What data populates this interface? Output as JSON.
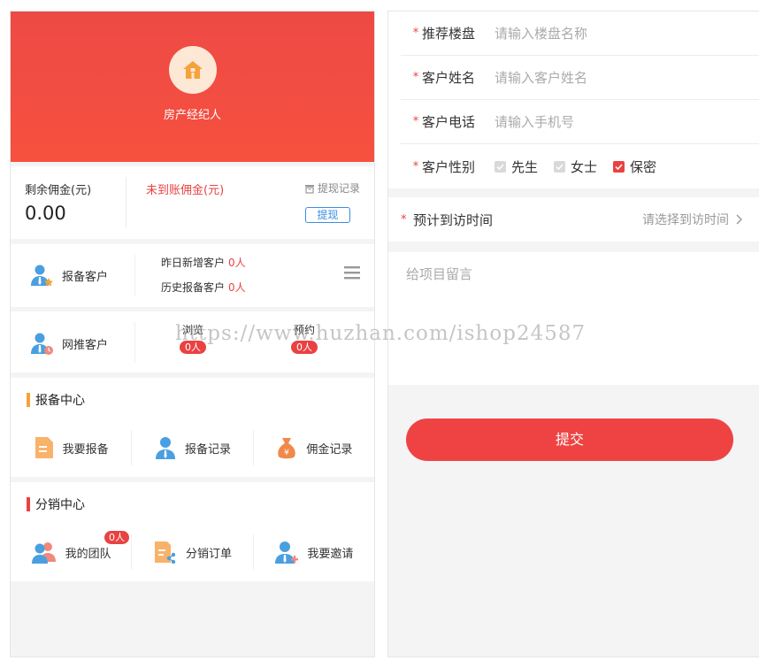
{
  "colors": {
    "brand_red": "#ee4a45",
    "accent_orange": "#f5a23a",
    "link_blue": "#3b8de3"
  },
  "hero": {
    "role": "房产经纪人",
    "icon": "house-icon"
  },
  "commission": {
    "remaining_label": "剩余佣金(元)",
    "remaining_amount": "0.00",
    "unbilled_label": "未到账佣金(元)",
    "history_label": "提现记录",
    "withdraw_label": "提现"
  },
  "report_row": {
    "label": "报备客户",
    "yesterday_label": "昨日新增客户",
    "yesterday_value": "0人",
    "history_label": "历史报备客户",
    "history_value": "0人"
  },
  "push_row": {
    "label": "网推客户",
    "browse_label": "浏览",
    "browse_value": "0人",
    "appoint_label": "预约",
    "appoint_value": "0人"
  },
  "report_center": {
    "title": "报备中心",
    "items": [
      {
        "label": "我要报备",
        "icon": "document-icon"
      },
      {
        "label": "报备记录",
        "icon": "person-icon"
      },
      {
        "label": "佣金记录",
        "icon": "money-bag-icon"
      }
    ]
  },
  "dist_center": {
    "title": "分销中心",
    "items": [
      {
        "label": "我的团队",
        "icon": "team-icon",
        "badge": "0人"
      },
      {
        "label": "分销订单",
        "icon": "share-doc-icon"
      },
      {
        "label": "我要邀请",
        "icon": "invite-icon"
      }
    ]
  },
  "form": {
    "building": {
      "star": "*",
      "label": "推荐楼盘",
      "placeholder": "请输入楼盘名称"
    },
    "name": {
      "star": "*",
      "label": "客户姓名",
      "placeholder": "请输入客户姓名"
    },
    "phone": {
      "star": "*",
      "label": "客户电话",
      "placeholder": "请输入手机号"
    },
    "gender": {
      "star": "*",
      "label": "客户性别",
      "options": [
        "先生",
        "女士",
        "保密"
      ],
      "selected": "保密"
    },
    "visit": {
      "star": "*",
      "label": "预计到访时间",
      "placeholder": "请选择到访时间"
    },
    "remark_placeholder": "给项目留言",
    "submit_label": "提交"
  },
  "watermark": "https://www.huzhan.com/ishop24587"
}
